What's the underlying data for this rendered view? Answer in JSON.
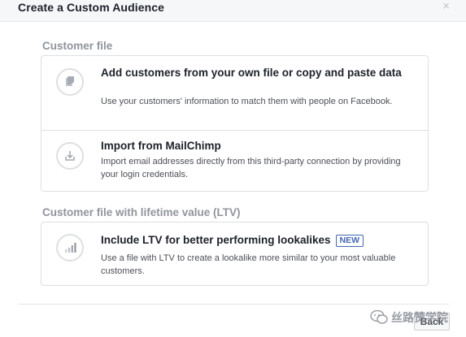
{
  "dialog": {
    "title": "Create a Custom Audience",
    "close_glyph": "×"
  },
  "sections": [
    {
      "heading": "Customer file",
      "options": [
        {
          "icon": "file-plus-icon",
          "title": "Add customers from your own file or copy and paste data",
          "description": "Use your customers' information to match them with people on Facebook."
        },
        {
          "icon": "import-icon",
          "title": "Import from MailChimp",
          "description": "Import email addresses directly from this third-party connection by providing your login credentials."
        }
      ]
    },
    {
      "heading": "Customer file with lifetime value (LTV)",
      "options": [
        {
          "icon": "bar-chart-icon",
          "title": "Include LTV for better performing lookalikes",
          "badge": "NEW",
          "description": "Use a file with LTV to create a lookalike more similar to your most valuable customers."
        }
      ]
    }
  ],
  "footer": {
    "back_label": "Back",
    "watermark": "丝路赞学院"
  },
  "colors": {
    "accent": "#4267b2",
    "border": "#dddfe2",
    "muted_heading": "#90949c"
  }
}
